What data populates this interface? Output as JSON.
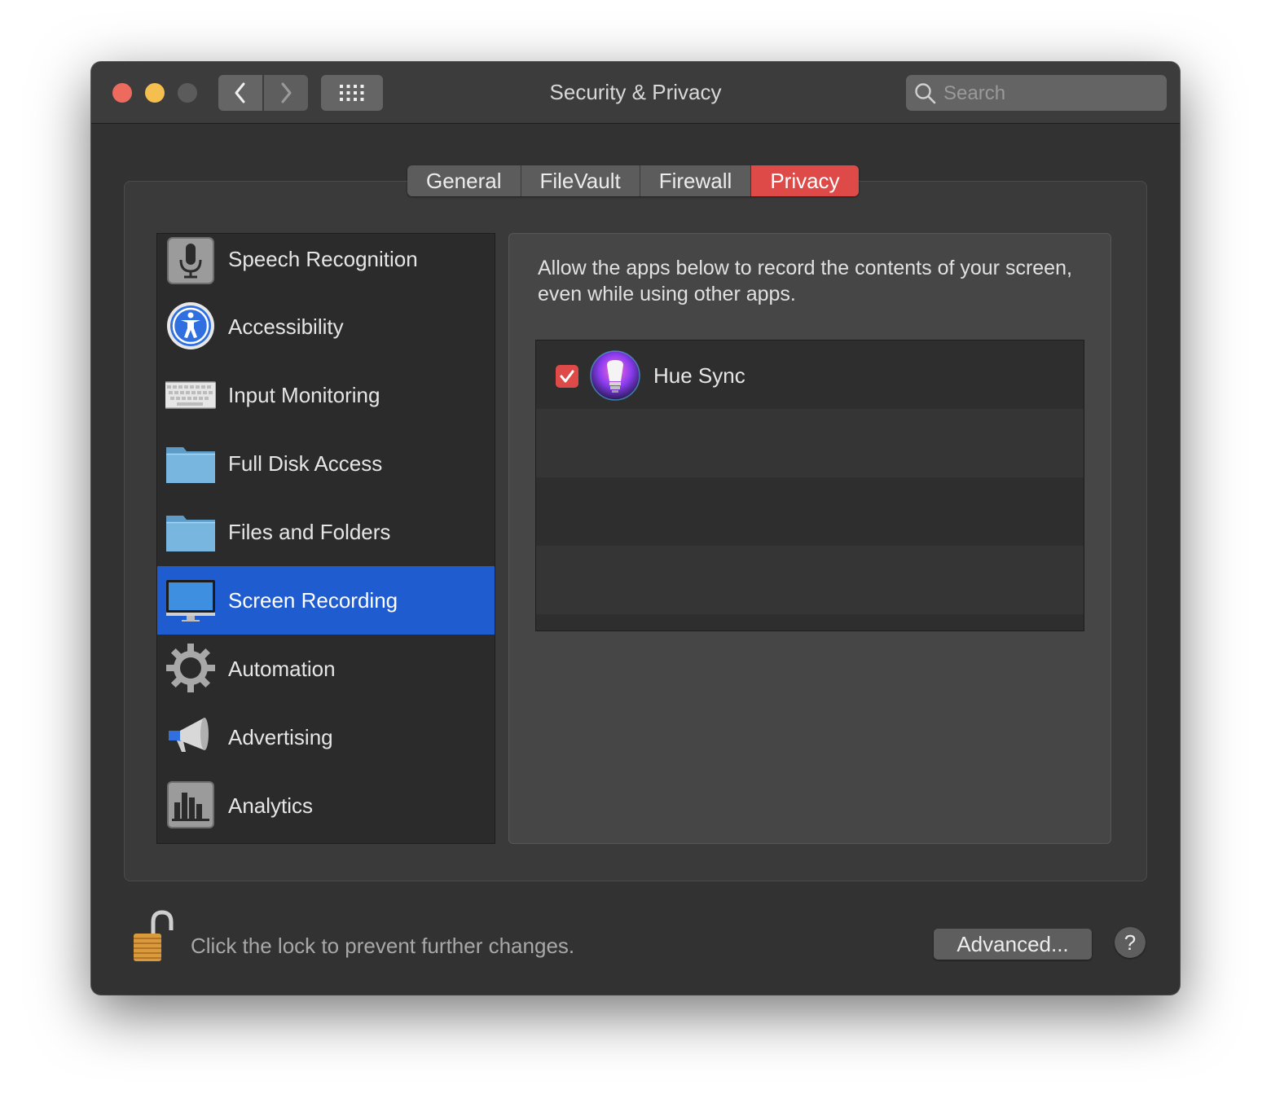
{
  "window": {
    "title": "Security & Privacy"
  },
  "toolbar": {
    "back_icon": "chevron-left-icon",
    "forward_icon": "chevron-right-icon",
    "grid_icon": "grid-icon",
    "search_placeholder": "Search"
  },
  "tabs": [
    {
      "label": "General",
      "active": false
    },
    {
      "label": "FileVault",
      "active": false
    },
    {
      "label": "Firewall",
      "active": false
    },
    {
      "label": "Privacy",
      "active": true
    }
  ],
  "sidebar": {
    "items": [
      {
        "label": "Speech Recognition",
        "icon": "microphone-icon",
        "selected": false
      },
      {
        "label": "Accessibility",
        "icon": "accessibility-icon",
        "selected": false
      },
      {
        "label": "Input Monitoring",
        "icon": "keyboard-icon",
        "selected": false
      },
      {
        "label": "Full Disk Access",
        "icon": "folder-icon",
        "selected": false
      },
      {
        "label": "Files and Folders",
        "icon": "folder-icon",
        "selected": false
      },
      {
        "label": "Screen Recording",
        "icon": "display-icon",
        "selected": true
      },
      {
        "label": "Automation",
        "icon": "gear-icon",
        "selected": false
      },
      {
        "label": "Advertising",
        "icon": "megaphone-icon",
        "selected": false
      },
      {
        "label": "Analytics",
        "icon": "bar-chart-icon",
        "selected": false
      }
    ]
  },
  "main": {
    "description": "Allow the apps below to record the contents of your screen, even while using other apps.",
    "apps": [
      {
        "name": "Hue Sync",
        "checked": true,
        "icon": "hue-sync-bulb-icon"
      }
    ]
  },
  "footer": {
    "lock_text": "Click the lock to prevent further changes.",
    "advanced_label": "Advanced...",
    "help_label": "?"
  },
  "colors": {
    "accent_selected": "#1f5ccf",
    "tab_active": "#de4a47",
    "checkbox": "#de4a47"
  }
}
